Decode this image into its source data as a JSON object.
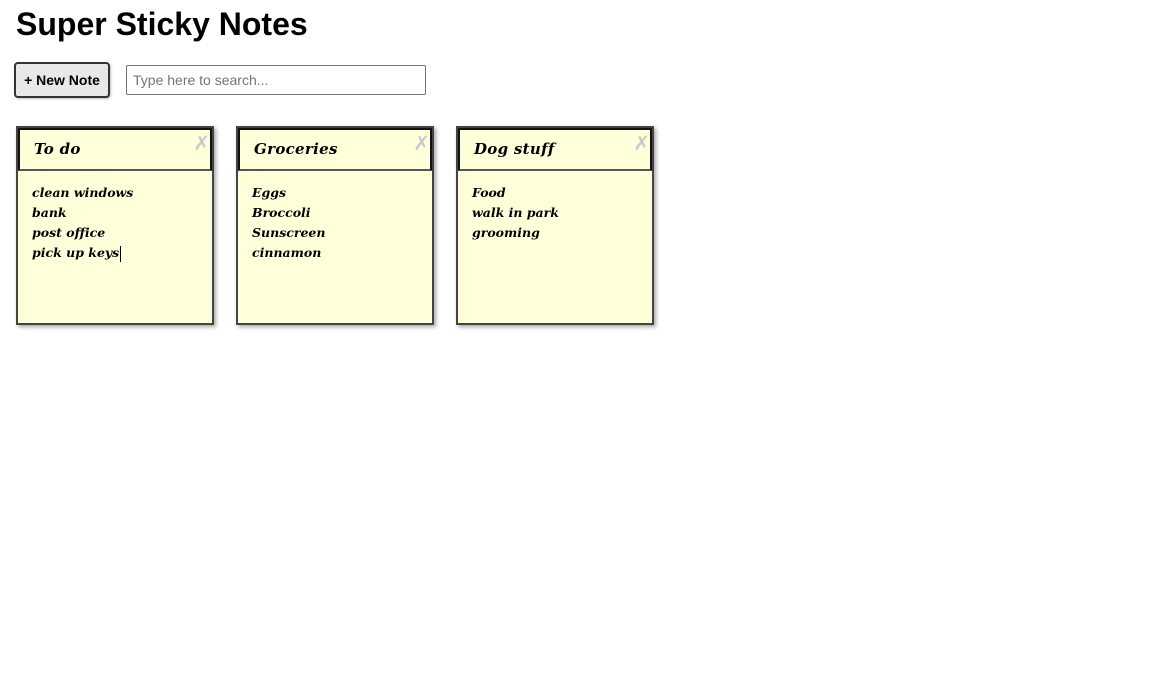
{
  "header": {
    "title": "Super Sticky Notes"
  },
  "toolbar": {
    "new_note_label": "+ New Note",
    "search_placeholder": "Type here to search...",
    "search_value": ""
  },
  "notes": [
    {
      "title": "To do",
      "lines": [
        "clean windows",
        "bank",
        "post office",
        "pick up keys"
      ]
    },
    {
      "title": "Groceries",
      "lines": [
        "Eggs",
        "Broccoli",
        "Sunscreen",
        "cinnamon"
      ]
    },
    {
      "title": "Dog stuff",
      "lines": [
        "Food",
        "walk in park",
        "grooming"
      ]
    }
  ],
  "close_glyph": "✗",
  "colors": {
    "note_background": "#ffffd9",
    "close_icon": "#c8c8c8"
  }
}
